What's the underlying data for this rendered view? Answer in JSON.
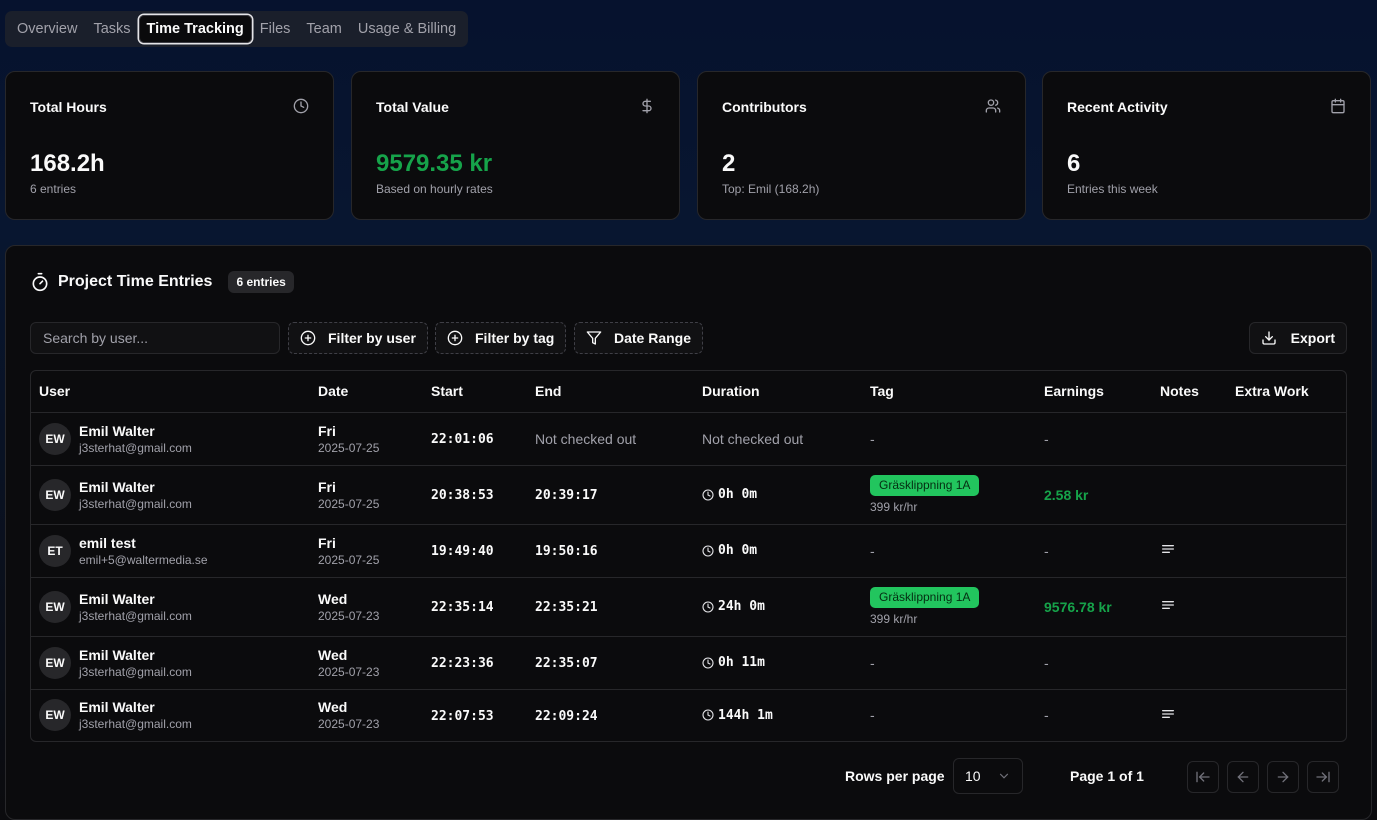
{
  "tabs": [
    {
      "label": "Overview",
      "active": false
    },
    {
      "label": "Tasks",
      "active": false
    },
    {
      "label": "Time Tracking",
      "active": true
    },
    {
      "label": "Files",
      "active": false
    },
    {
      "label": "Team",
      "active": false
    },
    {
      "label": "Usage & Billing",
      "active": false
    }
  ],
  "stats": [
    {
      "title": "Total Hours",
      "value": "168.2h",
      "sub": "6 entries",
      "icon": "clock-icon"
    },
    {
      "title": "Total Value",
      "value": "9579.35 kr",
      "sub": "Based on hourly rates",
      "icon": "dollar-icon",
      "value_color": "#16a34a"
    },
    {
      "title": "Contributors",
      "value": "2",
      "sub": "Top: Emil (168.2h)",
      "icon": "users-icon"
    },
    {
      "title": "Recent Activity",
      "value": "6",
      "sub": "Entries this week",
      "icon": "calendar-icon"
    }
  ],
  "panel": {
    "title": "Project Time Entries",
    "badge": "6 entries",
    "search_placeholder": "Search by user...",
    "filter_user": "Filter by user",
    "filter_tag": "Filter by tag",
    "date_range": "Date Range",
    "export": "Export"
  },
  "table": {
    "columns": [
      "User",
      "Date",
      "Start",
      "End",
      "Duration",
      "Tag",
      "Earnings",
      "Notes",
      "Extra Work"
    ],
    "rows": [
      {
        "initials": "EW",
        "name": "Emil Walter",
        "email": "j3sterhat@gmail.com",
        "day": "Fri",
        "date": "2025-07-25",
        "start": "22:01:06",
        "end": "Not checked out",
        "duration": "Not checked out",
        "tag": "-",
        "rate": "",
        "earnings": "-",
        "notes": false
      },
      {
        "initials": "EW",
        "name": "Emil Walter",
        "email": "j3sterhat@gmail.com",
        "day": "Fri",
        "date": "2025-07-25",
        "start": "20:38:53",
        "end": "20:39:17",
        "duration": "0h 0m",
        "tag": "Gräsklippning 1A",
        "rate": "399 kr/hr",
        "earnings": "2.58 kr",
        "notes": false
      },
      {
        "initials": "ET",
        "name": "emil test",
        "email": "emil+5@waltermedia.se",
        "day": "Fri",
        "date": "2025-07-25",
        "start": "19:49:40",
        "end": "19:50:16",
        "duration": "0h 0m",
        "tag": "-",
        "rate": "",
        "earnings": "-",
        "notes": true
      },
      {
        "initials": "EW",
        "name": "Emil Walter",
        "email": "j3sterhat@gmail.com",
        "day": "Wed",
        "date": "2025-07-23",
        "start": "22:35:14",
        "end": "22:35:21",
        "duration": "24h 0m",
        "tag": "Gräsklippning 1A",
        "rate": "399 kr/hr",
        "earnings": "9576.78 kr",
        "notes": true
      },
      {
        "initials": "EW",
        "name": "Emil Walter",
        "email": "j3sterhat@gmail.com",
        "day": "Wed",
        "date": "2025-07-23",
        "start": "22:23:36",
        "end": "22:35:07",
        "duration": "0h 11m",
        "tag": "-",
        "rate": "",
        "earnings": "-",
        "notes": false
      },
      {
        "initials": "EW",
        "name": "Emil Walter",
        "email": "j3sterhat@gmail.com",
        "day": "Wed",
        "date": "2025-07-23",
        "start": "22:07:53",
        "end": "22:09:24",
        "duration": "144h 1m",
        "tag": "-",
        "rate": "",
        "earnings": "-",
        "notes": true
      }
    ]
  },
  "pagination": {
    "rows_label": "Rows per page",
    "rows_value": "10",
    "page_label": "Page 1 of 1"
  },
  "colors": {
    "accent_green": "#16a34a",
    "tag_green": "#22c55e",
    "background": "#0b0b0d"
  }
}
